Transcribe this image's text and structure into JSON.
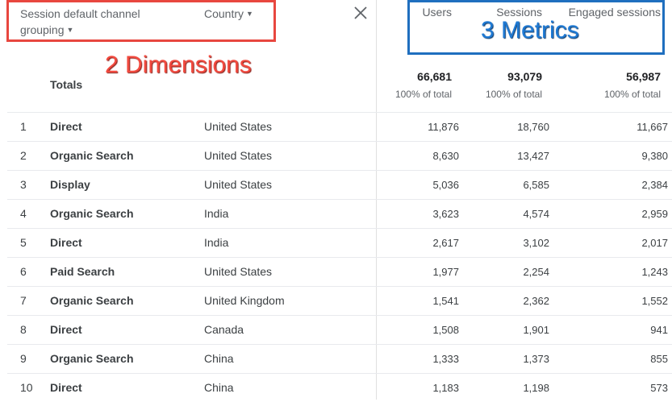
{
  "dimensions": [
    {
      "label": "Session default channel grouping"
    },
    {
      "label": "Country"
    }
  ],
  "metrics": [
    "Users",
    "Sessions",
    "Engaged sessions"
  ],
  "annotations": {
    "dimensions_label": "2 Dimensions",
    "metrics_label": "3 Metrics",
    "dimensions_color": "#e8473f",
    "metrics_color": "#1f6fbf"
  },
  "totals": {
    "label": "Totals",
    "values": [
      "66,681",
      "93,079",
      "56,987"
    ],
    "sublabels": [
      "100% of total",
      "100% of total",
      "100% of total"
    ]
  },
  "rows": [
    {
      "index": "1",
      "channel": "Direct",
      "country": "United States",
      "values": [
        "11,876",
        "18,760",
        "11,667"
      ]
    },
    {
      "index": "2",
      "channel": "Organic Search",
      "country": "United States",
      "values": [
        "8,630",
        "13,427",
        "9,380"
      ]
    },
    {
      "index": "3",
      "channel": "Display",
      "country": "United States",
      "values": [
        "5,036",
        "6,585",
        "2,384"
      ]
    },
    {
      "index": "4",
      "channel": "Organic Search",
      "country": "India",
      "values": [
        "3,623",
        "4,574",
        "2,959"
      ]
    },
    {
      "index": "5",
      "channel": "Direct",
      "country": "India",
      "values": [
        "2,617",
        "3,102",
        "2,017"
      ]
    },
    {
      "index": "6",
      "channel": "Paid Search",
      "country": "United States",
      "values": [
        "1,977",
        "2,254",
        "1,243"
      ]
    },
    {
      "index": "7",
      "channel": "Organic Search",
      "country": "United Kingdom",
      "values": [
        "1,541",
        "2,362",
        "1,552"
      ]
    },
    {
      "index": "8",
      "channel": "Direct",
      "country": "Canada",
      "values": [
        "1,508",
        "1,901",
        "941"
      ]
    },
    {
      "index": "9",
      "channel": "Organic Search",
      "country": "China",
      "values": [
        "1,333",
        "1,373",
        "855"
      ]
    },
    {
      "index": "10",
      "channel": "Direct",
      "country": "China",
      "values": [
        "1,183",
        "1,198",
        "573"
      ]
    }
  ]
}
